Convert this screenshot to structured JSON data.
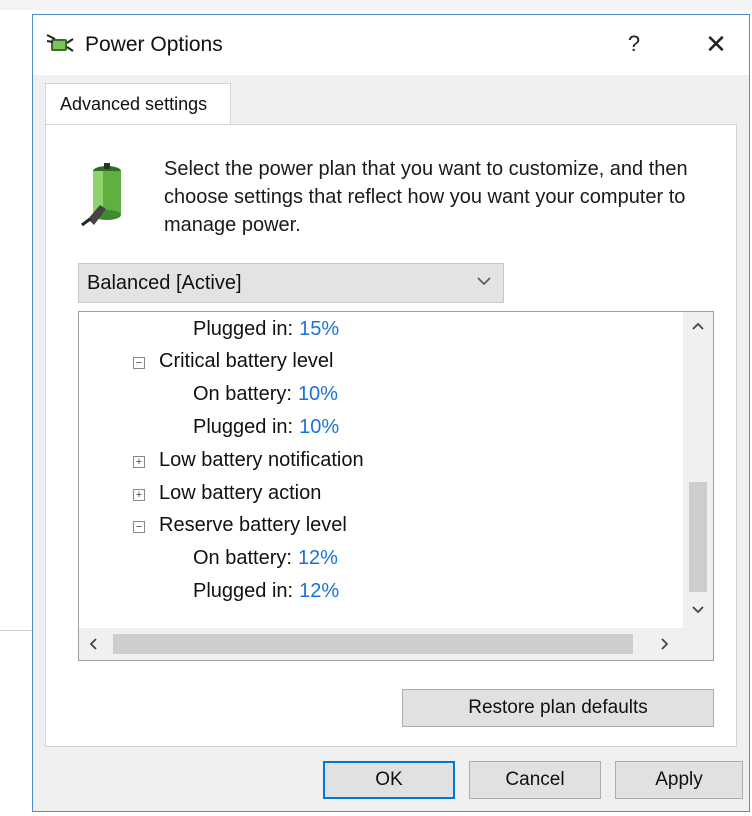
{
  "window": {
    "title": "Power Options",
    "help_symbol": "?",
    "close_symbol": "✕",
    "icon": "power-options-icon"
  },
  "tab": {
    "label": "Advanced settings"
  },
  "panel": {
    "description": "Select the power plan that you want to customize, and then choose settings that reflect how you want your computer to manage power.",
    "plan_select": {
      "value": "Balanced [Active]"
    }
  },
  "tree": {
    "rows": [
      {
        "label": "Plugged in:",
        "value": "15%"
      },
      {
        "label": "Critical battery level",
        "toggle": "−"
      },
      {
        "label": "On battery:",
        "value": "10%"
      },
      {
        "label": "Plugged in:",
        "value": "10%"
      },
      {
        "label": "Low battery notification",
        "toggle": "+"
      },
      {
        "label": "Low battery action",
        "toggle": "+"
      },
      {
        "label": "Reserve battery level",
        "toggle": "−"
      },
      {
        "label": "On battery:",
        "value": "12%"
      },
      {
        "label": "Plugged in:",
        "value": "12%"
      }
    ]
  },
  "buttons": {
    "restore": "Restore plan defaults",
    "ok": "OK",
    "cancel": "Cancel",
    "apply": "Apply"
  },
  "colors": {
    "accent": "#0078d7",
    "value_link": "#1a73d9",
    "window_border": "#4f8ccf"
  }
}
